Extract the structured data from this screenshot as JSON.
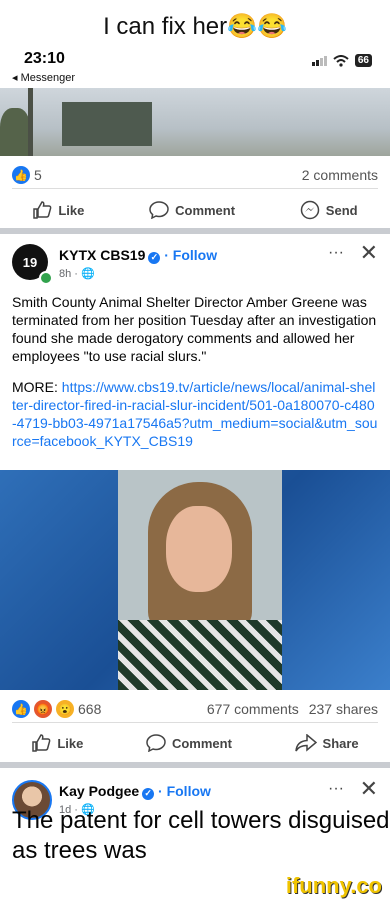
{
  "meme_caption": "I can fix her😂😂",
  "status_bar": {
    "time": "23:10",
    "back_label": "◂ Messenger",
    "battery": "66"
  },
  "post1": {
    "reaction_count": "5",
    "comments": "2 comments",
    "actions": {
      "like": "Like",
      "comment": "Comment",
      "send": "Send"
    }
  },
  "post2": {
    "page_name": "KYTX CBS19",
    "follow": "· Follow",
    "meta": "8h · 🌐",
    "avatar_text": "19",
    "text": "Smith County Animal Shelter Director Amber Greene was terminated from her position Tuesday after an investigation found she made derogatory comments and allowed her employees \"to use racial slurs.\"",
    "more_label": "MORE: ",
    "link": "https://www.cbs19.tv/article/news/local/animal-shelter-director-fired-in-racial-slur-incident/501-0a180070-c480-4719-bb03-4971a17546a5?utm_medium=social&utm_source=facebook_KYTX_CBS19",
    "reaction_count": "668",
    "comments": "677 comments",
    "shares": "237 shares",
    "actions": {
      "like": "Like",
      "comment": "Comment",
      "share": "Share"
    }
  },
  "post3": {
    "page_name": "Kay Podgee",
    "follow": "· Follow",
    "meta": "1d · 🌐",
    "text": "The patent for cell towers disguised as trees was"
  },
  "watermark": "ifunny.co",
  "more_glyph": "···",
  "close_glyph": "✕"
}
